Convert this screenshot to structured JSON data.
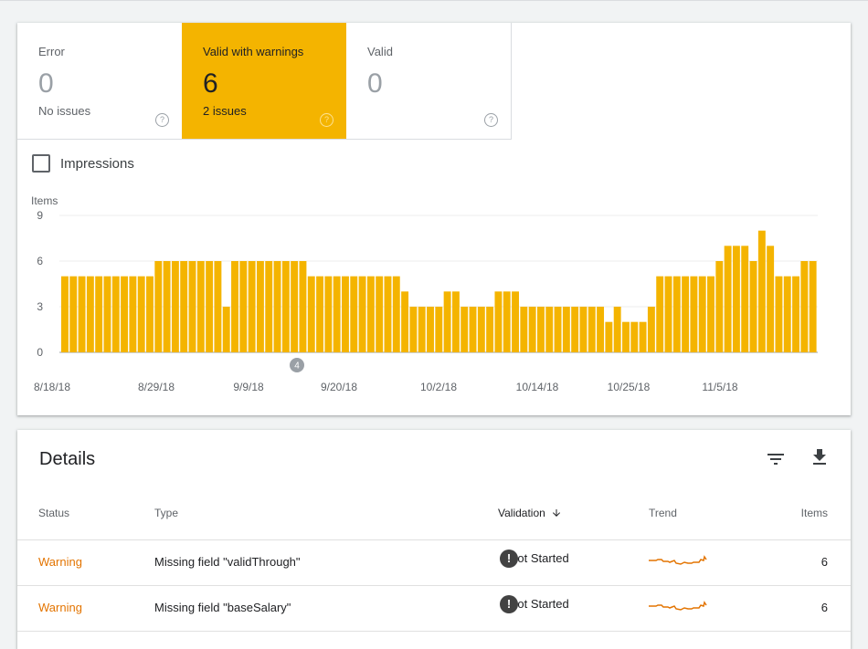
{
  "tiles": [
    {
      "label": "Error",
      "count": "0",
      "sub": "No issues"
    },
    {
      "label": "Valid with warnings",
      "count": "6",
      "sub": "2 issues"
    },
    {
      "label": "Valid",
      "count": "0",
      "sub": ""
    }
  ],
  "impressions_label": "Impressions",
  "chart_data": {
    "type": "bar",
    "ylabel": "Items",
    "ylim": [
      0,
      9
    ],
    "yticks": [
      "9",
      "6",
      "3",
      "0"
    ],
    "xticks": [
      "8/18/18",
      "8/29/18",
      "9/9/18",
      "9/20/18",
      "10/2/18",
      "10/14/18",
      "10/25/18",
      "11/5/18"
    ],
    "color": "#f4b400",
    "annotation": "4",
    "values": [
      5,
      5,
      5,
      5,
      5,
      5,
      5,
      5,
      5,
      5,
      5,
      6,
      6,
      6,
      6,
      6,
      6,
      6,
      6,
      3,
      6,
      6,
      6,
      6,
      6,
      6,
      6,
      6,
      6,
      5,
      5,
      5,
      5,
      5,
      5,
      5,
      5,
      5,
      5,
      5,
      4,
      3,
      3,
      3,
      3,
      4,
      4,
      3,
      3,
      3,
      3,
      4,
      4,
      4,
      3,
      3,
      3,
      3,
      3,
      3,
      3,
      3,
      3,
      3,
      2,
      3,
      2,
      2,
      2,
      3,
      5,
      5,
      5,
      5,
      5,
      5,
      5,
      6,
      7,
      7,
      7,
      6,
      8,
      7,
      5,
      5,
      5,
      6,
      6
    ]
  },
  "details": {
    "title": "Details",
    "columns": {
      "status": "Status",
      "type": "Type",
      "validation": "Validation",
      "trend": "Trend",
      "items": "Items"
    },
    "rows": [
      {
        "status": "Warning",
        "type": "Missing field \"validThrough\"",
        "validation": "Not Started",
        "items": "6"
      },
      {
        "status": "Warning",
        "type": "Missing field \"baseSalary\"",
        "validation": "Not Started",
        "items": "6"
      }
    ]
  }
}
